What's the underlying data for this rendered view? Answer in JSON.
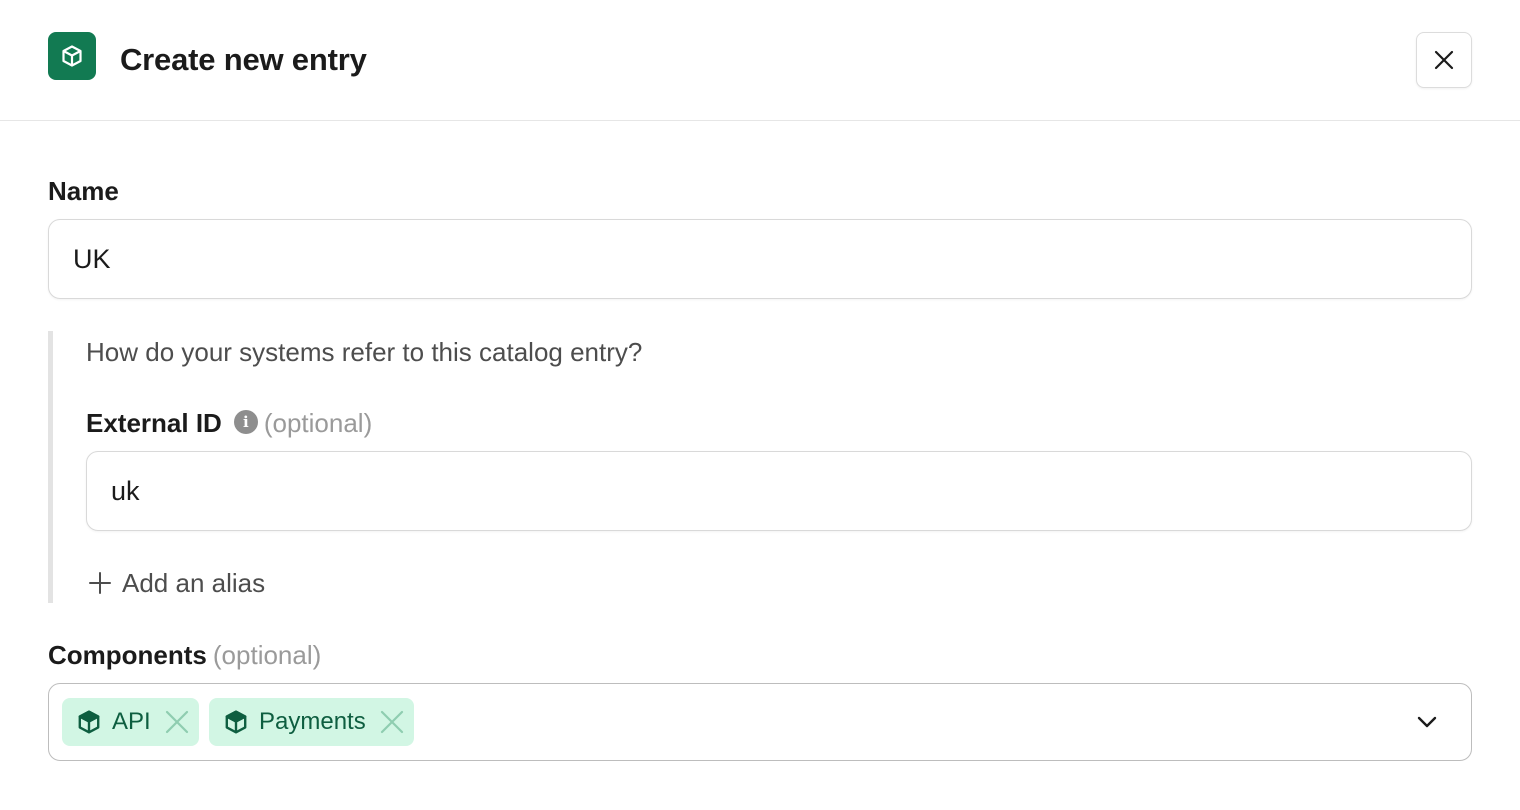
{
  "header": {
    "title": "Create new entry",
    "icon": "cube-icon",
    "close_icon": "close-icon"
  },
  "name_field": {
    "label": "Name",
    "value": "UK"
  },
  "aliases": {
    "question": "How do your systems refer to this catalog entry?",
    "external_id_label": "External ID",
    "info_icon": "info-icon",
    "optional_label": "(optional)",
    "external_id_value": "uk",
    "add_alias_label": "Add an alias"
  },
  "components": {
    "label": "Components",
    "optional_label": "(optional)",
    "chips": [
      {
        "label": "API",
        "icon": "cube-icon"
      },
      {
        "label": "Payments",
        "icon": "cube-icon"
      }
    ],
    "dropdown_icon": "chevron-down-icon"
  },
  "colors": {
    "brand": "#127a52",
    "chip_bg": "#d2f6e4",
    "chip_text": "#0e5e40"
  }
}
